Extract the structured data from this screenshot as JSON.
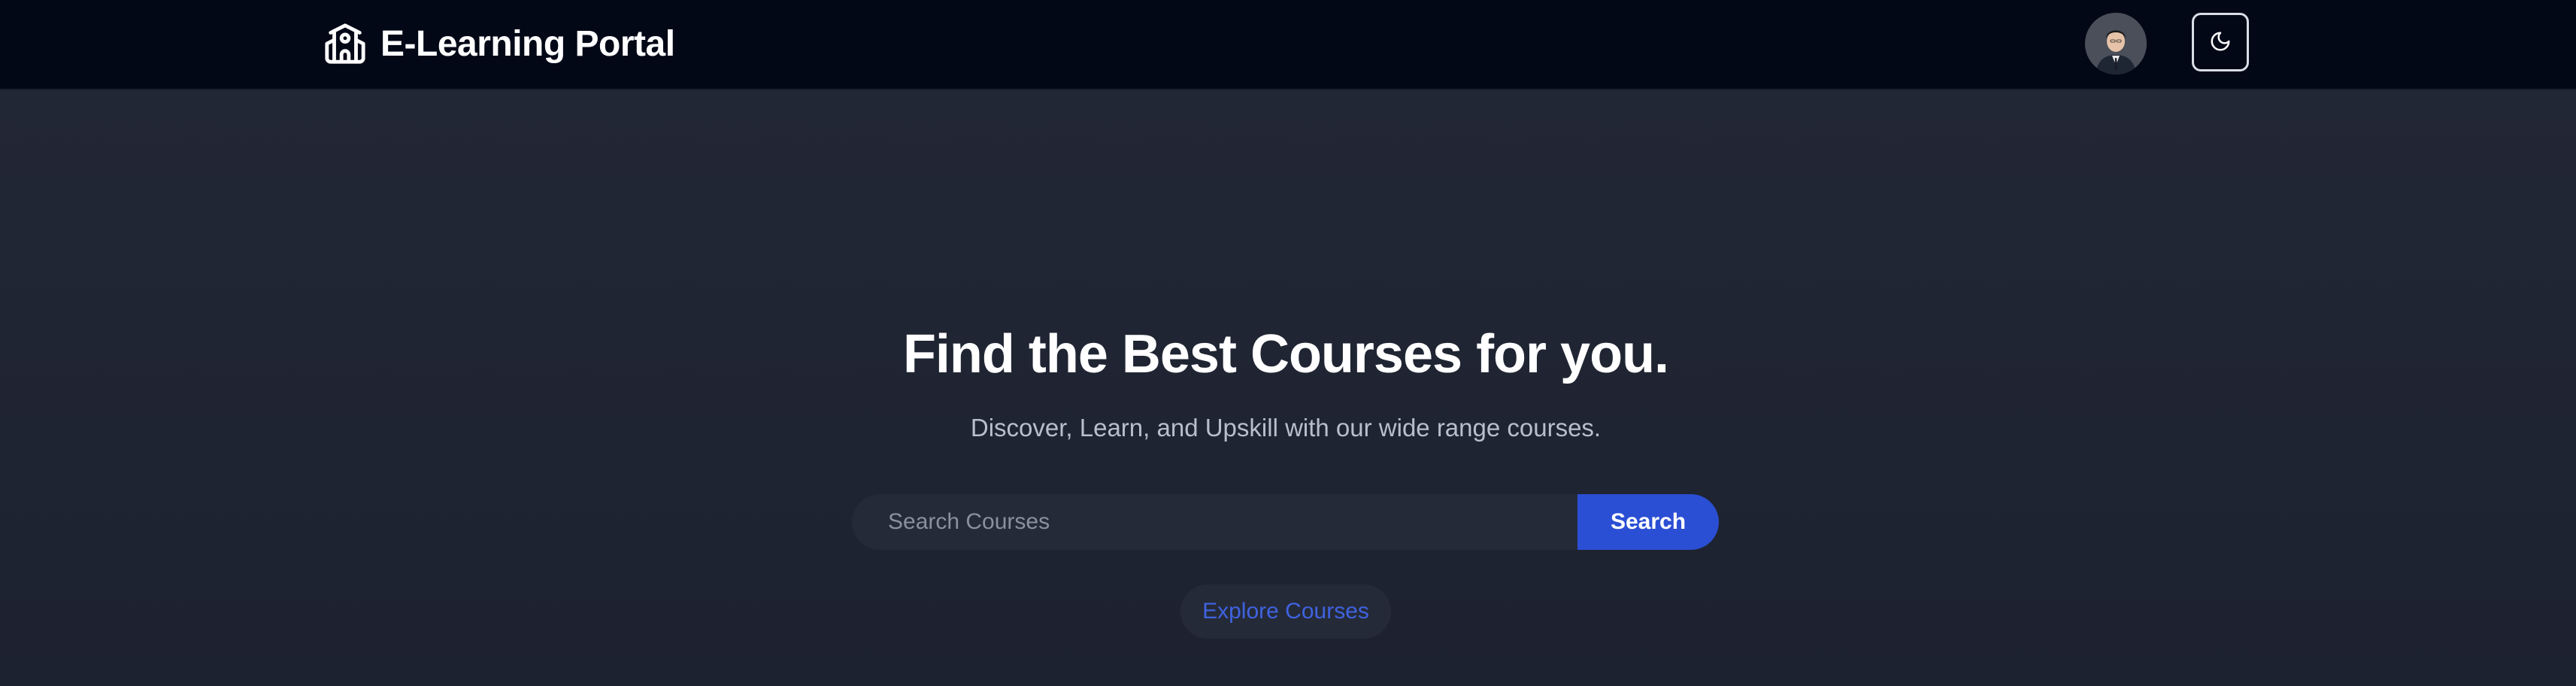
{
  "header": {
    "brand_title": "E-Learning Portal",
    "brand_icon": "school-icon",
    "avatar_icon": "user-avatar",
    "theme_toggle_icon": "moon-icon"
  },
  "hero": {
    "title": "Find the Best Courses for you.",
    "subtitle": "Discover, Learn, and Upskill with our wide range courses.",
    "search": {
      "placeholder": "Search Courses",
      "value": "",
      "button_label": "Search"
    },
    "explore_label": "Explore Courses"
  },
  "colors": {
    "topbar_bg": "#030817",
    "page_bg": "#1e2330",
    "accent": "#2b4fd4",
    "link": "#3f63e0"
  }
}
